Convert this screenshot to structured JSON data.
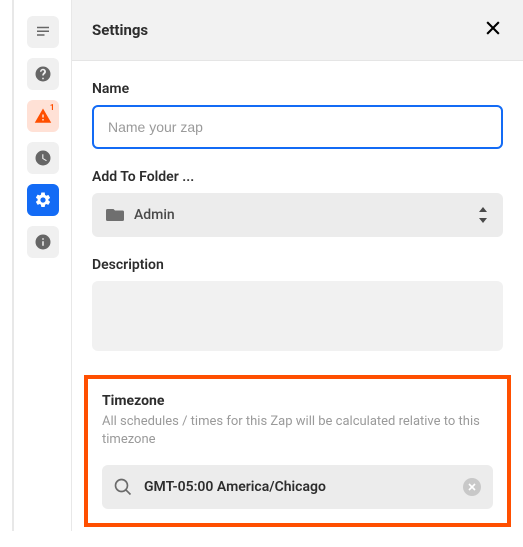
{
  "header": {
    "title": "Settings"
  },
  "rail": {
    "alerts_count": "1"
  },
  "fields": {
    "name": {
      "label": "Name",
      "placeholder": "Name your zap",
      "value": ""
    },
    "folder": {
      "label": "Add To Folder ...",
      "selected": "Admin"
    },
    "description": {
      "label": "Description",
      "value": ""
    },
    "timezone": {
      "label": "Timezone",
      "hint": "All schedules / times for this Zap will be calculated relative to this timezone",
      "value": "GMT-05:00 America/Chicago"
    }
  }
}
